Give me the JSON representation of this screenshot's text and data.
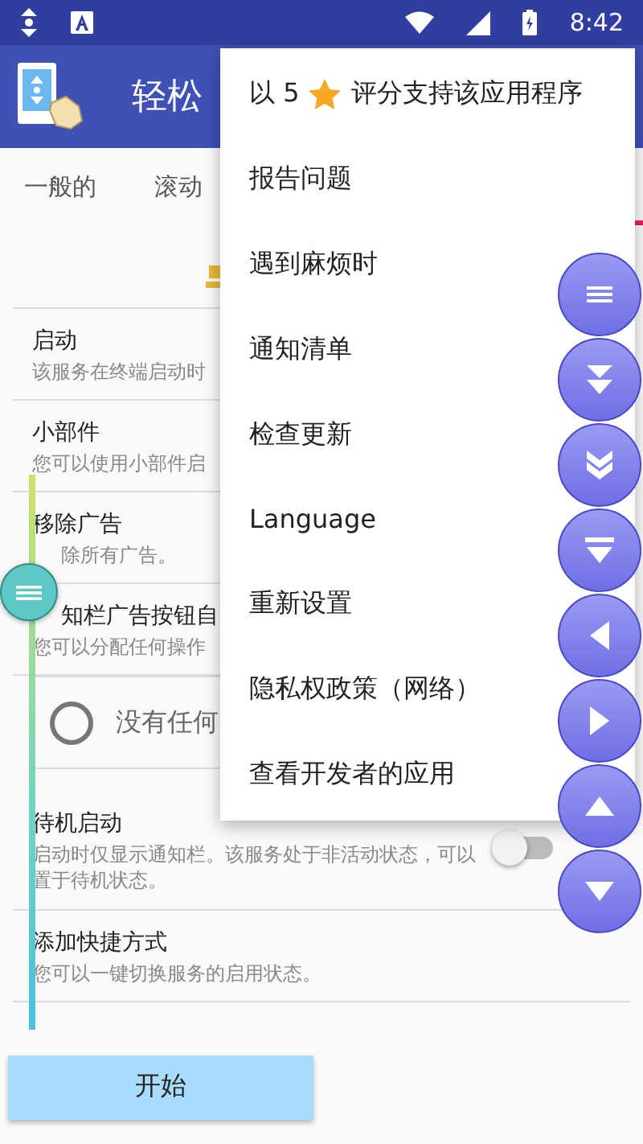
{
  "status_bar": {
    "time": "8:42"
  },
  "app_bar": {
    "title": "轻松"
  },
  "tabs": [
    {
      "label": "一般的",
      "selected": false
    },
    {
      "label": "滚动",
      "selected": false
    }
  ],
  "settings": [
    {
      "kind": "row",
      "title": "启动",
      "description": "该服务在终端启动时"
    },
    {
      "kind": "row",
      "title": "小部件",
      "description": "您可以使用小部件启"
    },
    {
      "kind": "row",
      "title": "移除广告",
      "description": "除所有广告。"
    },
    {
      "kind": "row",
      "title": "知栏广告按钮自",
      "description": "您可以分配任何操作"
    },
    {
      "kind": "radio",
      "label": "没有任何",
      "selected": false
    },
    {
      "kind": "toggle",
      "title": "待机启动",
      "description": "启动时仅显示通知栏。该服务处于非活动状态，可以置于待机状态。",
      "on": false
    },
    {
      "kind": "row",
      "title": "添加快捷方式",
      "description": "您可以一键切换服务的启用状态。"
    }
  ],
  "start_button": {
    "label": "开始"
  },
  "menu": [
    {
      "kind": "rating",
      "before": "以 5",
      "after": "评分支持该应用程序"
    },
    {
      "kind": "plain",
      "label": "报告问题"
    },
    {
      "kind": "plain",
      "label": "遇到麻烦时"
    },
    {
      "kind": "plain",
      "label": "通知清单"
    },
    {
      "kind": "plain",
      "label": "检查更新"
    },
    {
      "kind": "plain",
      "label": "Language"
    },
    {
      "kind": "plain",
      "label": "重新设置"
    },
    {
      "kind": "plain",
      "label": "隐私权政策（网络）"
    },
    {
      "kind": "plain",
      "label": "查看开发者的应用"
    }
  ],
  "float_buttons": [
    {
      "kind": "menu"
    },
    {
      "kind": "page-down"
    },
    {
      "kind": "fast-down"
    },
    {
      "kind": "bottom"
    },
    {
      "kind": "left"
    },
    {
      "kind": "right"
    },
    {
      "kind": "up"
    },
    {
      "kind": "down"
    }
  ]
}
